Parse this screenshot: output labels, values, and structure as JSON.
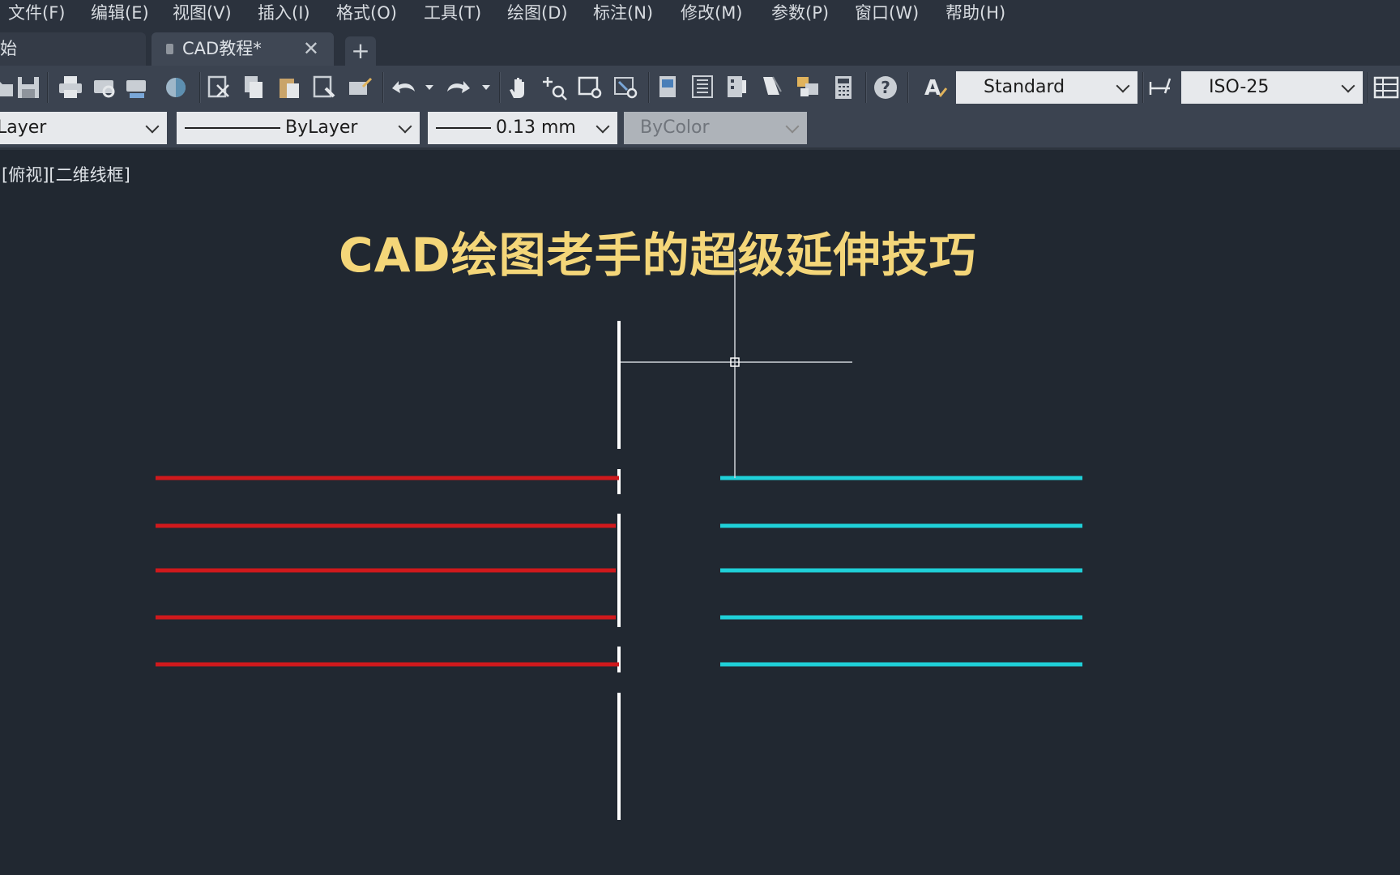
{
  "menu": [
    "文件(F)",
    "编辑(E)",
    "视图(V)",
    "插入(I)",
    "格式(O)",
    "工具(T)",
    "绘图(D)",
    "标注(N)",
    "修改(M)",
    "参数(P)",
    "窗口(W)",
    "帮助(H)"
  ],
  "tabs": {
    "start_label": "始",
    "active_label": "CAD教程*",
    "close_symbol": "✕",
    "add_symbol": "+"
  },
  "toolbar": {
    "text_style": "Standard",
    "dim_style": "ISO-25",
    "icons": [
      "open-icon",
      "save-icon",
      "print-icon",
      "plot-preview-icon",
      "publish-icon",
      "3d-dwf-icon",
      "cut-icon",
      "copy-icon",
      "paste-icon",
      "match-properties-icon",
      "block-editor-icon",
      "undo-icon",
      "redo-icon",
      "pan-icon",
      "zoom-realtime-icon",
      "zoom-window-icon",
      "zoom-previous-icon",
      "properties-icon",
      "design-center-icon",
      "tool-palettes-icon",
      "sheet-set-icon",
      "markup-icon",
      "calculator-icon",
      "help-icon",
      "text-style-icon",
      "dim-style-icon",
      "table-style-icon"
    ]
  },
  "properties": {
    "layer": "Layer",
    "linetype": "ByLayer",
    "lineweight": "0.13 mm",
    "plotstyle": "ByColor"
  },
  "viewport_label": "[俯视][二维线框]",
  "title": "CAD绘图老手的超级延伸技巧",
  "colors": {
    "title": "#f4d679",
    "red_lines": "#d0191c",
    "cyan_lines": "#1fd0d8",
    "boundary": "#ffffff",
    "background": "#212831"
  }
}
